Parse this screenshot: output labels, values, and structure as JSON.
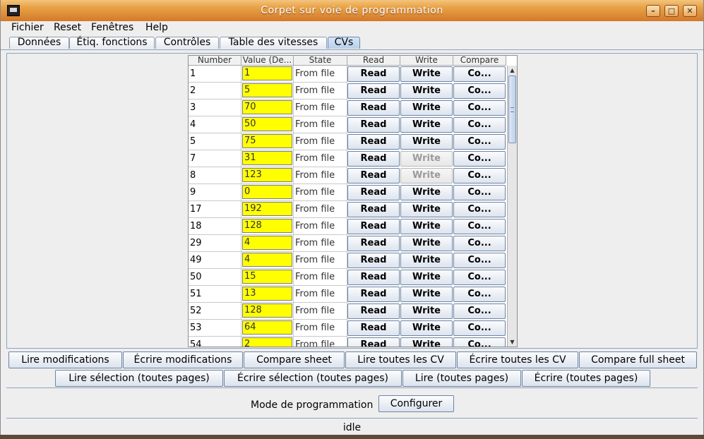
{
  "window": {
    "title": "Corpet sur voie de programmation",
    "min_icon": "minimize-icon",
    "max_icon": "maximize-icon",
    "close_icon": "close-icon"
  },
  "menu": [
    "Fichier",
    "Reset",
    "Fenêtres",
    "Help"
  ],
  "tabs": [
    {
      "label": "Données",
      "active": false
    },
    {
      "label": "Étiq. fonctions",
      "active": false
    },
    {
      "label": "Contrôles",
      "active": false
    },
    {
      "label": "Table des vitesses",
      "active": false
    },
    {
      "label": "CVs",
      "active": true
    }
  ],
  "table": {
    "headers": [
      "Number",
      "Value (De...",
      "State",
      "Read",
      "Write",
      "Compare"
    ],
    "rows": [
      {
        "number": "1",
        "value": "1",
        "state": "From file",
        "read": "Read",
        "write": "Write",
        "compare": "Co...",
        "write_enabled": true
      },
      {
        "number": "2",
        "value": "5",
        "state": "From file",
        "read": "Read",
        "write": "Write",
        "compare": "Co...",
        "write_enabled": true
      },
      {
        "number": "3",
        "value": "70",
        "state": "From file",
        "read": "Read",
        "write": "Write",
        "compare": "Co...",
        "write_enabled": true
      },
      {
        "number": "4",
        "value": "50",
        "state": "From file",
        "read": "Read",
        "write": "Write",
        "compare": "Co...",
        "write_enabled": true
      },
      {
        "number": "5",
        "value": "75",
        "state": "From file",
        "read": "Read",
        "write": "Write",
        "compare": "Co...",
        "write_enabled": true
      },
      {
        "number": "7",
        "value": "31",
        "state": "From file",
        "read": "Read",
        "write": "Write",
        "compare": "Co...",
        "write_enabled": false
      },
      {
        "number": "8",
        "value": "123",
        "state": "From file",
        "read": "Read",
        "write": "Write",
        "compare": "Co...",
        "write_enabled": false
      },
      {
        "number": "9",
        "value": "0",
        "state": "From file",
        "read": "Read",
        "write": "Write",
        "compare": "Co...",
        "write_enabled": true
      },
      {
        "number": "17",
        "value": "192",
        "state": "From file",
        "read": "Read",
        "write": "Write",
        "compare": "Co...",
        "write_enabled": true
      },
      {
        "number": "18",
        "value": "128",
        "state": "From file",
        "read": "Read",
        "write": "Write",
        "compare": "Co...",
        "write_enabled": true
      },
      {
        "number": "29",
        "value": "4",
        "state": "From file",
        "read": "Read",
        "write": "Write",
        "compare": "Co...",
        "write_enabled": true
      },
      {
        "number": "49",
        "value": "4",
        "state": "From file",
        "read": "Read",
        "write": "Write",
        "compare": "Co...",
        "write_enabled": true
      },
      {
        "number": "50",
        "value": "15",
        "state": "From file",
        "read": "Read",
        "write": "Write",
        "compare": "Co...",
        "write_enabled": true
      },
      {
        "number": "51",
        "value": "13",
        "state": "From file",
        "read": "Read",
        "write": "Write",
        "compare": "Co...",
        "write_enabled": true
      },
      {
        "number": "52",
        "value": "128",
        "state": "From file",
        "read": "Read",
        "write": "Write",
        "compare": "Co...",
        "write_enabled": true
      },
      {
        "number": "53",
        "value": "64",
        "state": "From file",
        "read": "Read",
        "write": "Write",
        "compare": "Co...",
        "write_enabled": true
      },
      {
        "number": "54",
        "value": "2",
        "state": "From file",
        "read": "Read",
        "write": "Write",
        "compare": "Co...",
        "write_enabled": true
      }
    ]
  },
  "buttons_row1": [
    "Lire modifications",
    "Écrire modifications",
    "Compare sheet",
    "Lire toutes les CV",
    "Écrire toutes les CV",
    "Compare full sheet"
  ],
  "buttons_row2": [
    "Lire sélection (toutes pages)",
    "Écrire sélection (toutes pages)",
    "Lire (toutes pages)",
    "Écrire (toutes pages)"
  ],
  "mode": {
    "label": "Mode de programmation",
    "button": "Configurer"
  },
  "status": "idle",
  "colors": {
    "value_cell": "#ffff00",
    "titlebar": "#e8a245"
  }
}
